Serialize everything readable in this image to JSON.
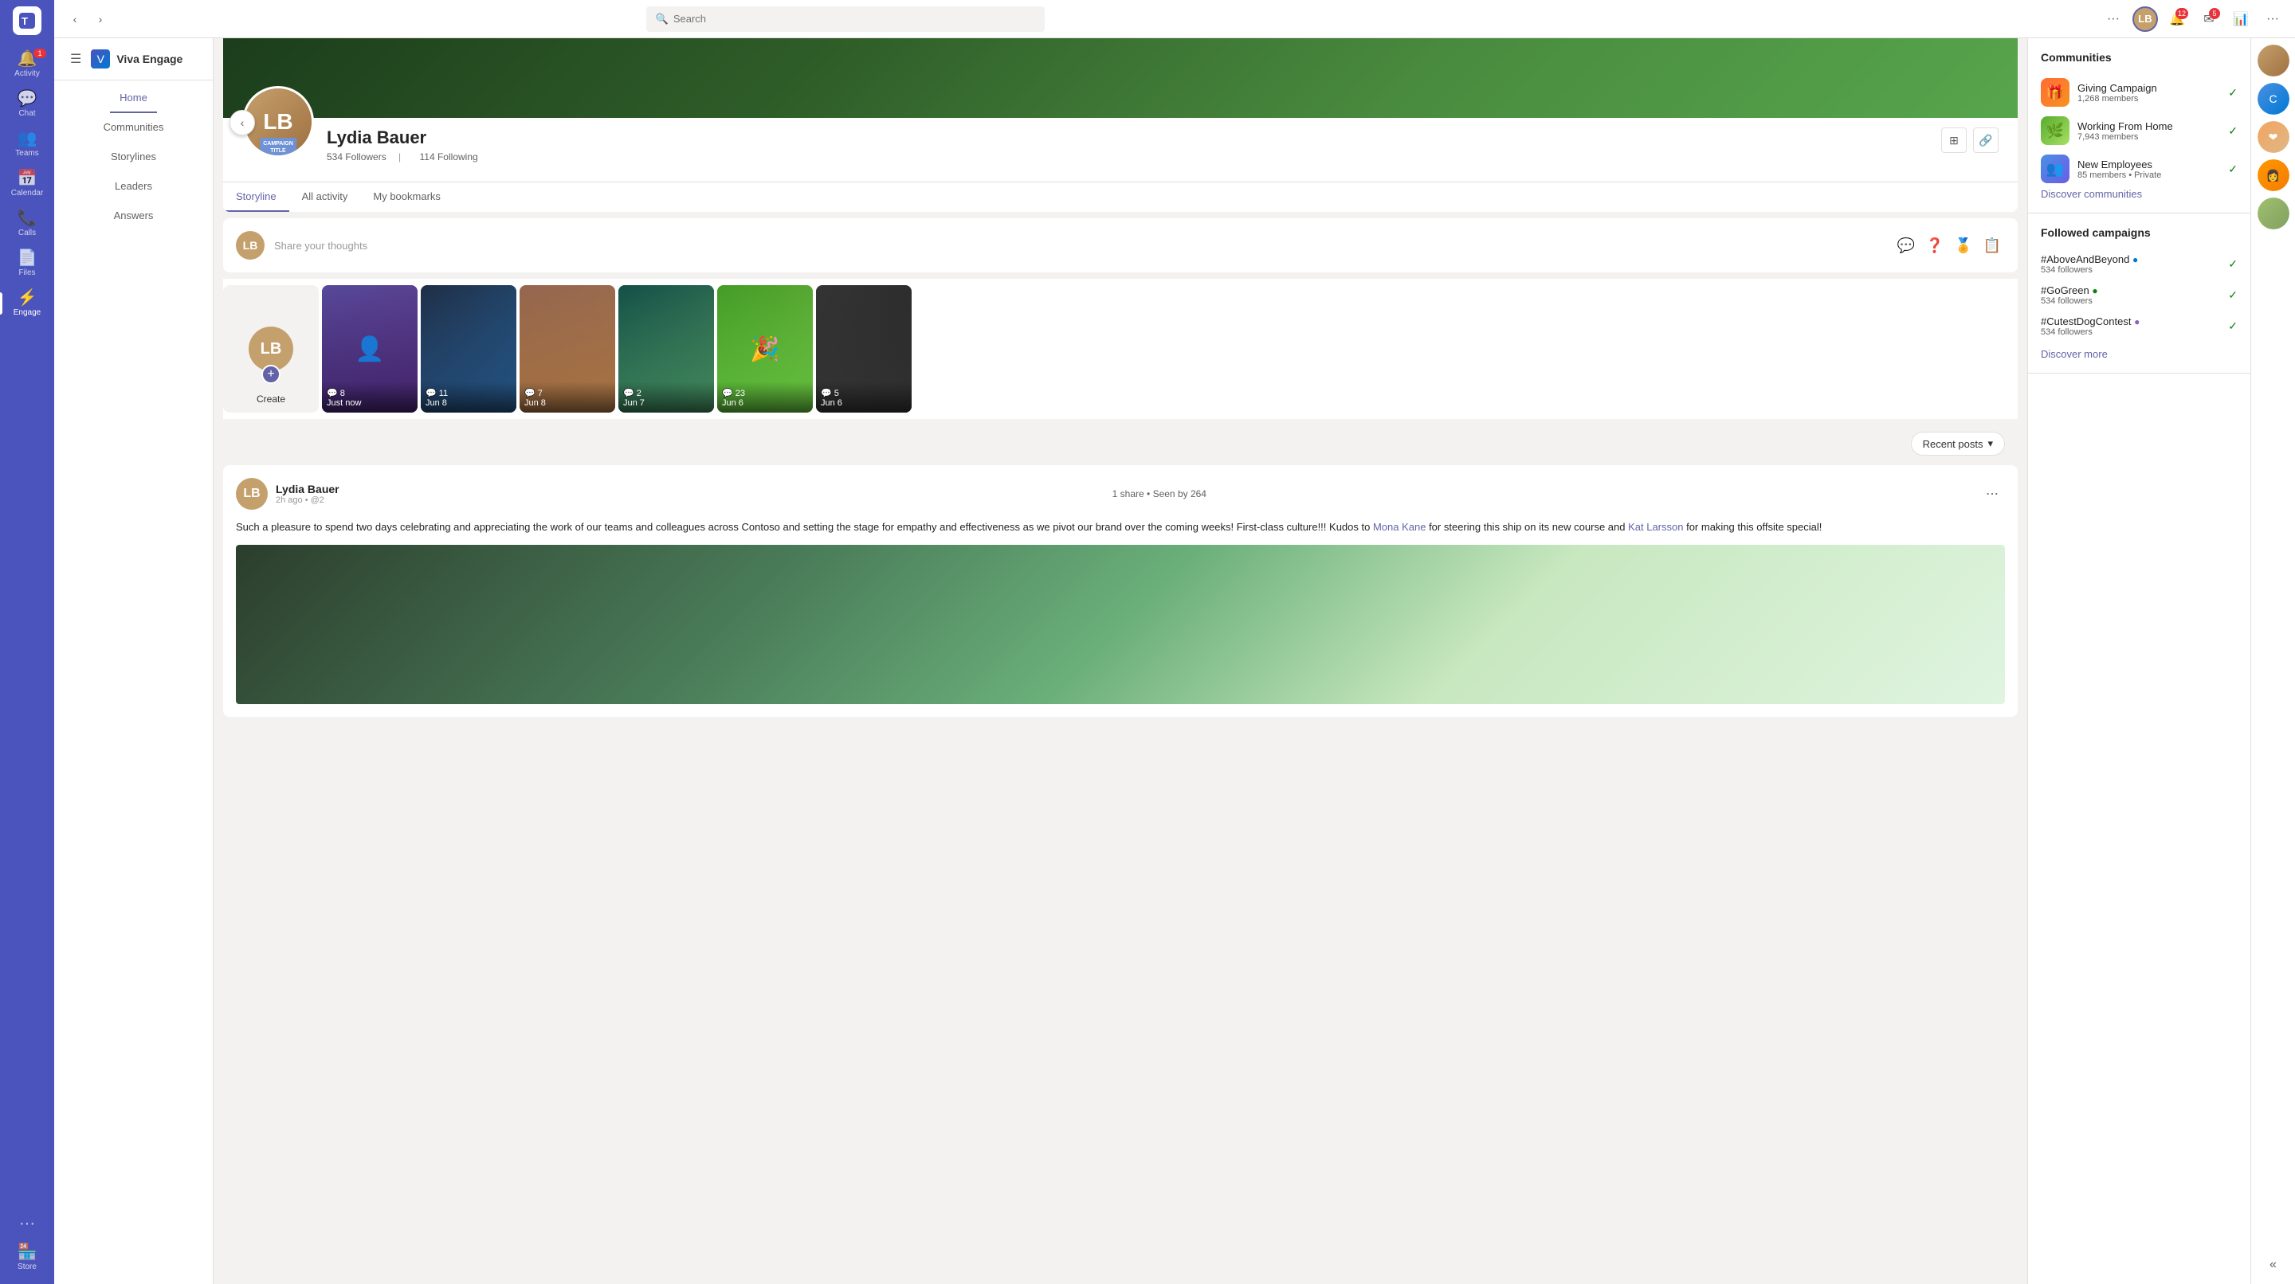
{
  "app": {
    "title": "Viva Engage",
    "logo_text": "✦"
  },
  "topbar": {
    "back_label": "‹",
    "forward_label": "›",
    "search_placeholder": "Search",
    "more_label": "···",
    "notification_count": "12",
    "message_count": "5"
  },
  "nav": {
    "items": [
      {
        "label": "Activity",
        "icon": "🔔",
        "badge": "1"
      },
      {
        "label": "Chat",
        "icon": "💬"
      },
      {
        "label": "Teams",
        "icon": "👥"
      },
      {
        "label": "Calendar",
        "icon": "📅"
      },
      {
        "label": "Calls",
        "icon": "📞"
      },
      {
        "label": "Files",
        "icon": "📄"
      },
      {
        "label": "Engage",
        "icon": "⚡",
        "active": true
      }
    ],
    "more_label": "···",
    "store_label": "Store",
    "store_icon": "🏪"
  },
  "viva_nav": {
    "home": "Home",
    "communities": "Communities",
    "storylines": "Storylines",
    "leaders": "Leaders",
    "answers": "Answers"
  },
  "profile": {
    "name": "Lydia Bauer",
    "followers": "534 Followers",
    "following": "114 Following",
    "tabs": [
      "Storyline",
      "All activity",
      "My bookmarks"
    ],
    "active_tab": "Storyline",
    "campaign_badge": "CAMPAIGN\nTITLe"
  },
  "share": {
    "placeholder": "Share your thoughts"
  },
  "stories": [
    {
      "label": "Create",
      "is_create": true
    },
    {
      "comments": "8",
      "date": "Just now",
      "bg": "story-bg-1"
    },
    {
      "comments": "11",
      "date": "Jun 8",
      "bg": "story-bg-2"
    },
    {
      "comments": "7",
      "date": "Jun 8",
      "bg": "story-bg-3"
    },
    {
      "comments": "2",
      "date": "Jun 7",
      "bg": "story-bg-4"
    },
    {
      "comments": "23",
      "date": "Jun 6",
      "bg": "story-bg-5"
    },
    {
      "comments": "5",
      "date": "Jun 6",
      "bg": "story-bg-6"
    }
  ],
  "recent_posts": {
    "label": "Recent posts",
    "icon": "▾"
  },
  "post": {
    "author": "Lydia Bauer",
    "time": "2h ago",
    "mention": "@2",
    "shares": "1 share",
    "seen": "Seen by 264",
    "content": "Such a pleasure to spend two days celebrating and appreciating the work of our teams and colleagues across Contoso and setting the stage for empathy and effectiveness as we pivot our brand over the coming weeks! First-class culture!!! Kudos to ",
    "link1": "Mona Kane",
    "content2": " for steering this ship on its new course and ",
    "link2": "Kat Larsson",
    "content3": " for making this offsite special!"
  },
  "communities": {
    "title": "Communities",
    "items": [
      {
        "name": "Giving Campaign",
        "members": "1,268 members",
        "icon_class": "community-icon-1"
      },
      {
        "name": "Working From Home",
        "members": "7,943 members",
        "icon_class": "community-icon-2"
      },
      {
        "name": "New Employees",
        "members": "85 members • Private",
        "icon_class": "community-icon-3"
      }
    ],
    "discover_link": "Discover communities"
  },
  "campaigns": {
    "title": "Followed campaigns",
    "items": [
      {
        "name": "#AboveAndBeyond",
        "followers": "534 followers",
        "dot": "●",
        "dot_class": "campaign-dot-blue"
      },
      {
        "name": "#GoGreen",
        "followers": "534 followers",
        "dot": "●",
        "dot_class": "campaign-dot-green"
      },
      {
        "name": "#CutestDogContest",
        "followers": "534 followers",
        "dot": "●",
        "dot_class": "campaign-dot-purple"
      }
    ],
    "discover_link": "Discover more"
  }
}
